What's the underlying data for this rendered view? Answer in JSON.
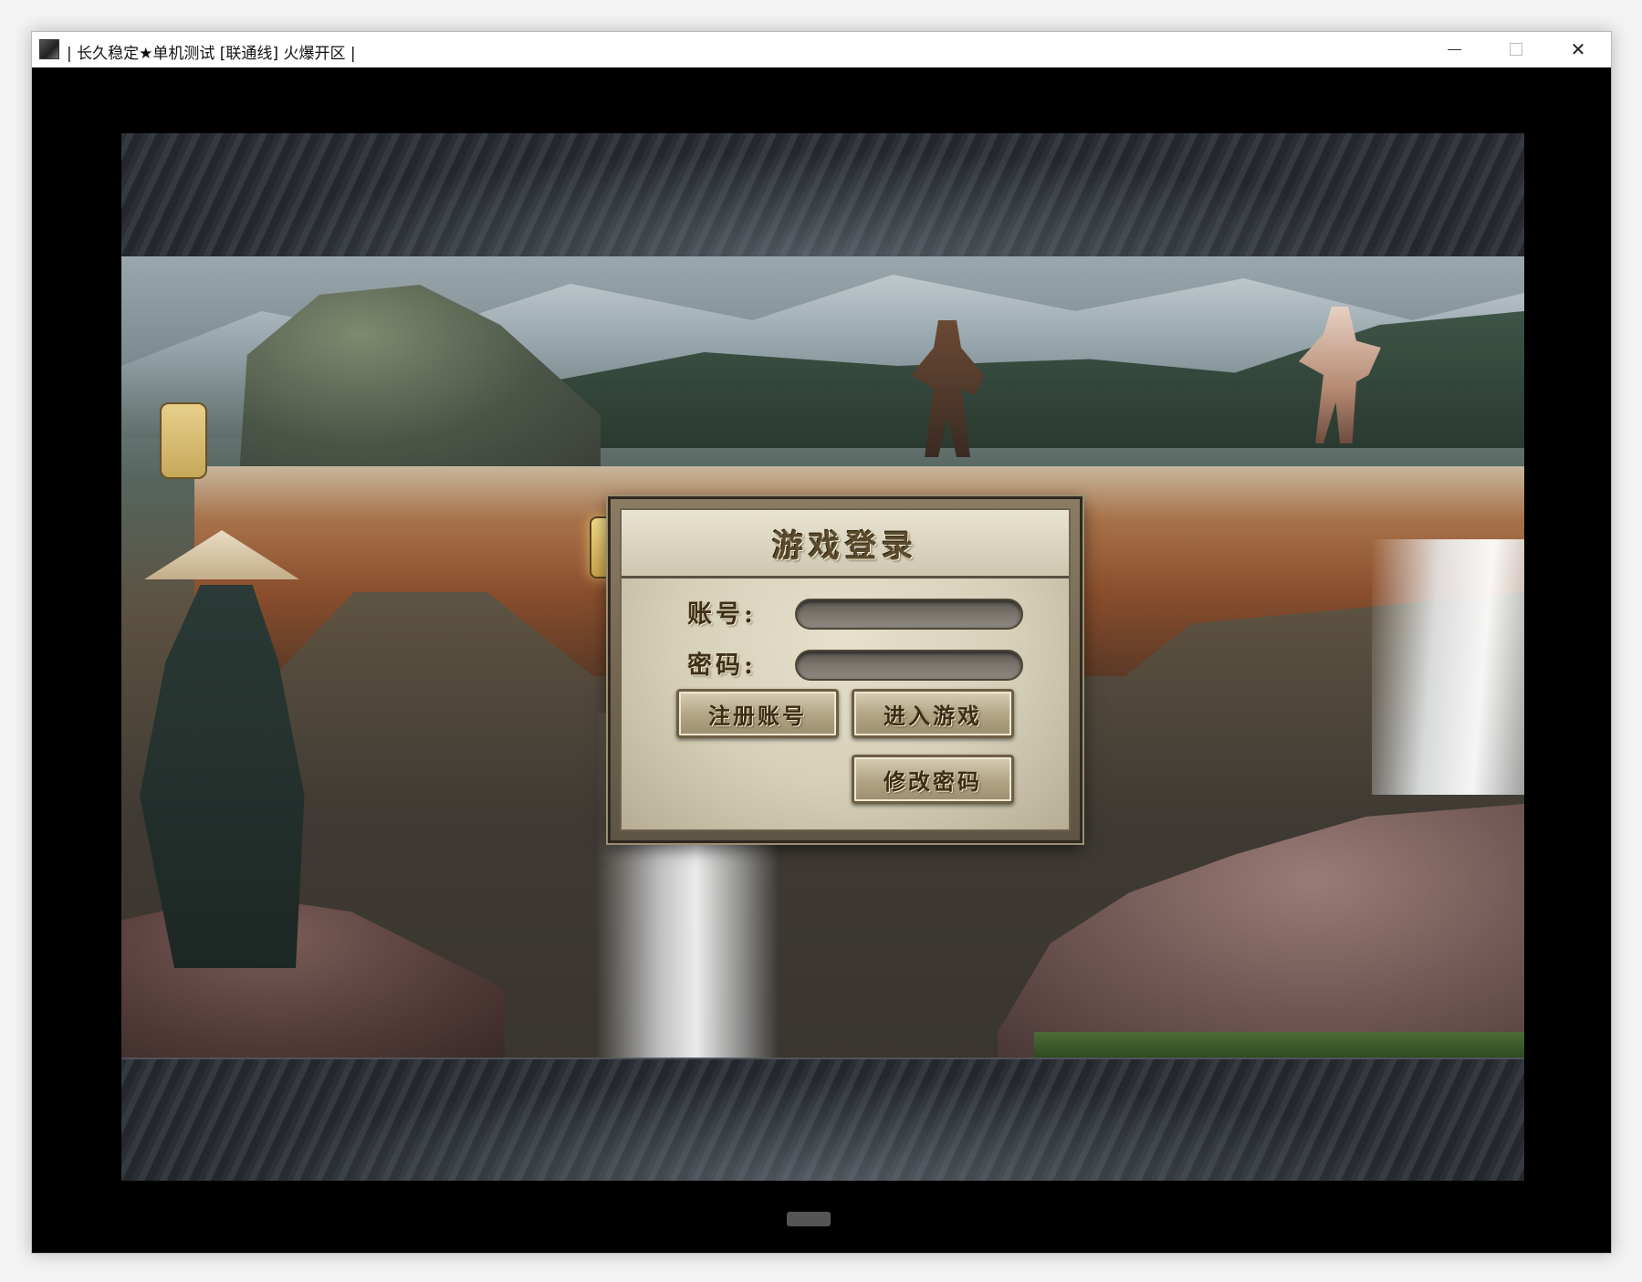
{
  "window": {
    "title": "| 长久稳定★单机测试 [联通线] 火爆开区 |",
    "icon": "app-icon",
    "controls": {
      "minimize": "minimize-icon",
      "maximize": "maximize-icon",
      "close": "close-icon"
    }
  },
  "login": {
    "title": "游戏登录",
    "account_label": "账号:",
    "password_label": "密码:",
    "account_value": "",
    "password_value": "",
    "register_label": "注册账号",
    "enter_label": "进入游戏",
    "change_password_label": "修改密码"
  },
  "colors": {
    "panel": "#d6cfb8",
    "panel_border": "#5e5444",
    "text": "#3e2f1a"
  }
}
